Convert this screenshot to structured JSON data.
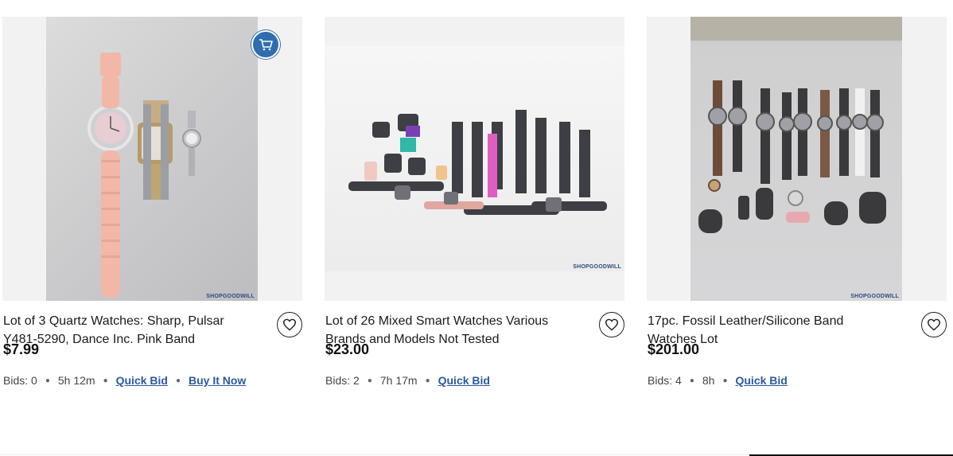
{
  "colors": {
    "link": "#2a5aa0",
    "cart_badge": "#2f6db0",
    "image_bg": "#f2f2f2"
  },
  "listings": [
    {
      "title": "Lot of 3 Quartz Watches: Sharp, Pulsar Y481-5290, Dance Inc. Pink Band",
      "price": "$7.99",
      "bids": "Bids: 0",
      "time_left": "5h 12m",
      "quick_bid": "Quick Bid",
      "buy_now": "Buy It Now",
      "watermark": "SHOPGOODWILL",
      "has_cart_icon": true
    },
    {
      "title": "Lot of 26 Mixed Smart Watches Various Brands and Models Not Tested",
      "price": "$23.00",
      "bids": "Bids: 2",
      "time_left": "7h 17m",
      "quick_bid": "Quick Bid",
      "watermark": "SHOPGOODWILL"
    },
    {
      "title": "17pc. Fossil Leather/Silicone Band Watches Lot",
      "price": "$201.00",
      "bids": "Bids: 4",
      "time_left": "8h",
      "quick_bid": "Quick Bid",
      "watermark": "SHOPGOODWILL"
    }
  ]
}
